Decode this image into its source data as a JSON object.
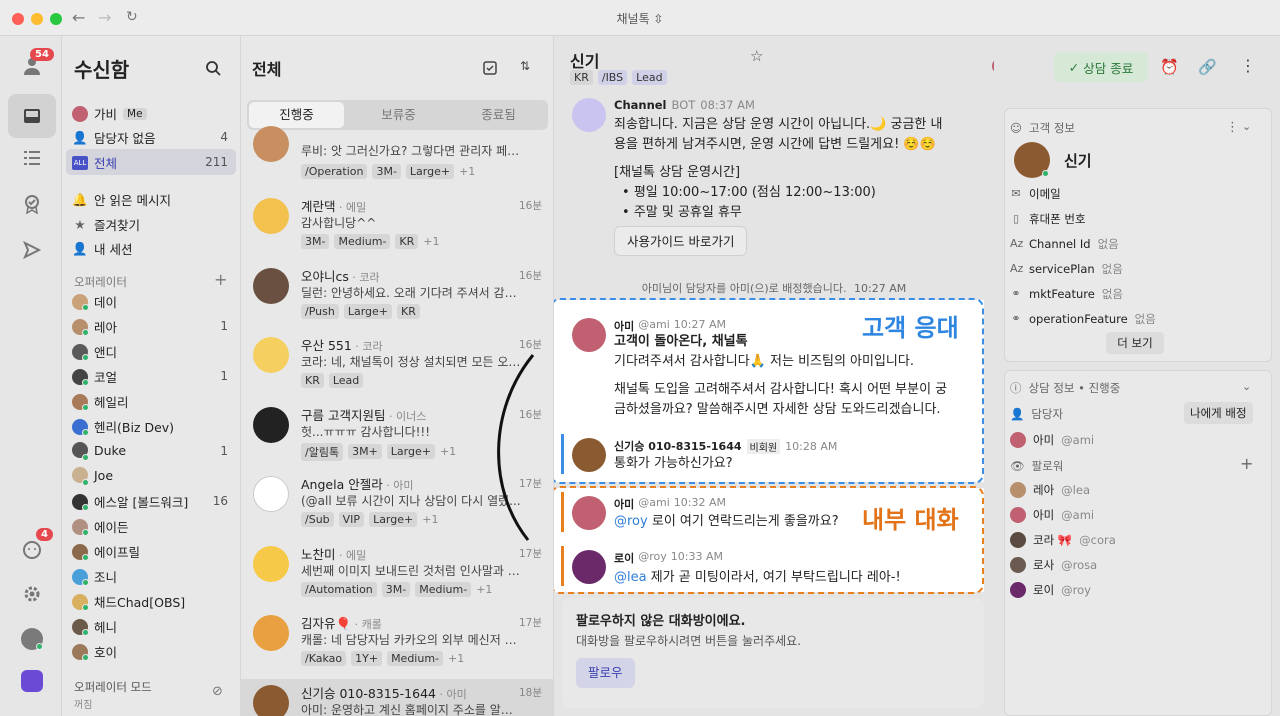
{
  "window": {
    "title": "채널톡 ⇳"
  },
  "rail": {
    "inbox_badge": "54",
    "bottom_badge": "4"
  },
  "sidebar": {
    "title": "수신함",
    "items": [
      {
        "label": "가비",
        "extra": "Me"
      },
      {
        "label": "담당자 없음",
        "count": "4"
      },
      {
        "label": "전체",
        "count": "211"
      },
      {
        "label": "안 읽은 메시지"
      },
      {
        "label": "즐겨찾기"
      },
      {
        "label": "내 세션"
      }
    ],
    "operators_header": "오퍼레이터",
    "operators": [
      {
        "name": "데이",
        "count": "",
        "color": "#c9a27a"
      },
      {
        "name": "레아",
        "count": "1",
        "color": "#b78f6d"
      },
      {
        "name": "앤디",
        "count": "",
        "color": "#5a5a5a"
      },
      {
        "name": "코얼",
        "count": "1",
        "color": "#444"
      },
      {
        "name": "헤일리",
        "count": "",
        "color": "#a97a5a"
      },
      {
        "name": "헨리(Biz Dev)",
        "count": "",
        "color": "#3b6fd1"
      },
      {
        "name": "Duke",
        "count": "1",
        "color": "#555"
      },
      {
        "name": "Joe",
        "count": "",
        "color": "#c8b090"
      },
      {
        "name": "에스알 [볼드워크]",
        "count": "16",
        "color": "#333"
      },
      {
        "name": "에이든",
        "count": "",
        "color": "#b09080"
      },
      {
        "name": "에이프릴",
        "count": "",
        "color": "#8a6a4a"
      },
      {
        "name": "조니",
        "count": "",
        "color": "#4a9fd8"
      },
      {
        "name": "채드Chad[OBS]",
        "count": "",
        "color": "#d8b060"
      },
      {
        "name": "헤니",
        "count": "",
        "color": "#6a5a4a"
      },
      {
        "name": "호이",
        "count": "",
        "color": "#9a7a5a"
      }
    ],
    "operator_mode": "오퍼레이터 모드",
    "operator_mode_state": "꺼짐"
  },
  "list": {
    "title": "전체",
    "tabs": [
      "진행중",
      "보류중",
      "종료됨"
    ],
    "items": [
      {
        "name": "",
        "sub": "",
        "time": "",
        "preview": "루비: 앗 그러신가요? 그렇다면 관리자 페이...",
        "tags": [
          "/Operation",
          "3M-",
          "Large+"
        ],
        "more": "+1",
        "color": "#c89060"
      },
      {
        "name": "계란댁",
        "sub": " · 에밀",
        "time": "16분",
        "preview": "감사합니당^^",
        "tags": [
          "3M-",
          "Medium-",
          "KR"
        ],
        "more": "+1",
        "color": "#f2c14e"
      },
      {
        "name": "오야니cs",
        "sub": " · 코라",
        "time": "16분",
        "preview": "딜런: 안녕하세요. 오래 기다려 주셔서 감사...",
        "tags": [
          "/Push",
          "Large+",
          "KR"
        ],
        "more": "",
        "color": "#6a5040"
      },
      {
        "name": "우산 551",
        "sub": " · 코라",
        "time": "16분",
        "preview": "코라: 네, 채널톡이 정상 설치되면 모든 오퍼...",
        "tags": [
          "KR",
          "Lead"
        ],
        "more": "",
        "color": "#f5d060"
      },
      {
        "name": "구름 고객지원팀",
        "sub": " · 이너스",
        "time": "16분",
        "preview": "헛...ㅠㅠㅠ 감사합니다!!!",
        "tags": [
          "/알림톡",
          "3M+",
          "Large+"
        ],
        "more": "+1",
        "color": "#222"
      },
      {
        "name": "Angela 안젤라",
        "sub": " · 아미",
        "time": "17분",
        "preview": "(@all 보류 시간이 지나 상담이 다시 열렸...",
        "tags": [
          "/Sub",
          "VIP",
          "Large+"
        ],
        "more": "+1",
        "color": "#fff"
      },
      {
        "name": "노찬미",
        "sub": " · 에밀",
        "time": "17분",
        "preview": "세번째 이미지 보내드린 것처럼 인사말과 상...",
        "tags": [
          "/Automation",
          "3M-",
          "Medium-"
        ],
        "more": "+1",
        "color": "#f7c948"
      },
      {
        "name": "김자유🎈",
        "sub": " · 캐롤",
        "time": "17분",
        "preview": "캐롤: 네 담당자님 카카오의 외부 메신저 정...",
        "tags": [
          "/Kakao",
          "1Y+",
          "Medium-"
        ],
        "more": "+1",
        "color": "#e8a040"
      },
      {
        "name": "신기승 010-8315-1644",
        "sub": " · 아미",
        "time": "18분",
        "preview": "아미: 운영하고 계신 홈페이지 주소를 알려...",
        "tags": [],
        "more": "",
        "color": "#8a5a30"
      }
    ]
  },
  "chat": {
    "title": "신기",
    "tags": [
      "KR",
      "/IBS",
      "Lead"
    ],
    "assignee": "아미",
    "end_button": "상담 종료",
    "bot_name": "Channel",
    "bot_badge": "BOT",
    "bot_time": "08:37 AM",
    "bot_text1": "죄송합니다. 지금은 상담 운영 시간이 아닙니다.🌙 궁금한 내",
    "bot_text2": "용을 편하게 남겨주시면, 운영 시간에 답변 드릴게요! ☺️☺️",
    "bot_hours_title": "[채널톡 상담 운영시간]",
    "bot_hours1": "평일 10:00~17:00 (점심 12:00~13:00)",
    "bot_hours2": "주말 및 공휴일 휴무",
    "guide_button": "사용가이드 바로가기",
    "system_msg": "아미님이 담당자를 아미(으)로 배정했습니다.",
    "system_time": "10:27 AM",
    "label_customer": "고객 응대",
    "label_internal": "내부 대화",
    "m1_name": "아미",
    "m1_handle": "@ami",
    "m1_time": "10:27 AM",
    "m1_bold": "고객이 돌아온다, 채널톡",
    "m1_text": "기다려주셔서 감사합니다🙏 저는 비즈팀의 아미입니다.",
    "m1_text2": "채널톡 도입을 고려해주셔서 감사합니다! 혹시 어떤 부분이 궁",
    "m1_text3": "금하셨을까요? 말씀해주시면 자세한 상담 도와드리겠습니다.",
    "m2_name": "신기승 010-8315-1644",
    "m2_badge": "비회원",
    "m2_time": "10:28 AM",
    "m2_text": "통화가 가능하신가요?",
    "m3_name": "아미",
    "m3_handle": "@ami",
    "m3_time": "10:32 AM",
    "m3_mention": "@roy",
    "m3_text": "로이 여기 연락드리는게 좋을까요?",
    "m4_name": "로이",
    "m4_handle": "@roy",
    "m4_time": "10:33 AM",
    "m4_mention": "@lea",
    "m4_text": "제가 곧 미팅이라서, 여기 부탁드립니다 레아-!",
    "follow_title": "팔로우하지 않은 대화방이에요.",
    "follow_desc": "대화방을 팔로우하시려면 버튼을 눌러주세요.",
    "follow_button": "팔로우"
  },
  "right": {
    "section1": "고객 정보",
    "customer_name": "신기",
    "fields": [
      {
        "key": "이메일",
        "val": ""
      },
      {
        "key": "휴대폰 번호",
        "val": ""
      },
      {
        "key": "Channel Id",
        "val": "없음"
      },
      {
        "key": "servicePlan",
        "val": "없음"
      },
      {
        "key": "mktFeature",
        "val": "없음"
      },
      {
        "key": "operationFeature",
        "val": "없음"
      }
    ],
    "more": "더 보기",
    "section2": "상담 정보 • 진행중",
    "assignee_label": "담당자",
    "assign_me": "나에게 배정",
    "assignee": {
      "name": "아미",
      "handle": "@ami"
    },
    "followers_label": "팔로워",
    "followers": [
      {
        "name": "레아",
        "handle": "@lea",
        "color": "#b78f6d"
      },
      {
        "name": "아미",
        "handle": "@ami",
        "color": "#c06070"
      },
      {
        "name": "코라 🎀",
        "handle": "@cora",
        "color": "#5a4a40"
      },
      {
        "name": "로사",
        "handle": "@rosa",
        "color": "#6a5a50"
      },
      {
        "name": "로이",
        "handle": "@roy",
        "color": "#6a2a6a"
      }
    ]
  }
}
